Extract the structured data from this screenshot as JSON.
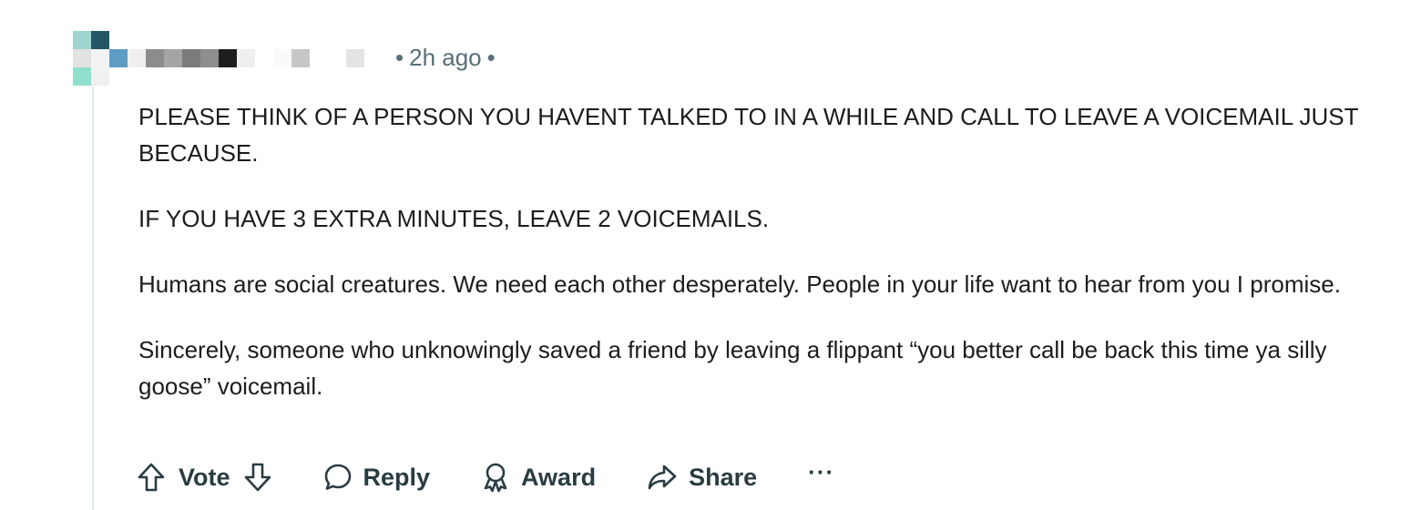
{
  "comment": {
    "meta": {
      "separator": "•",
      "timestamp": "2h ago"
    },
    "body": [
      "PLEASE THINK OF A PERSON YOU HAVENT TALKED TO IN A WHILE AND CALL TO LEAVE A VOICEMAIL JUST BECAUSE.",
      "IF YOU HAVE 3 EXTRA MINUTES, LEAVE 2 VOICEMAILS.",
      "Humans are social creatures. We need each other desperately. People in your life want to hear from you I promise.",
      "Sincerely, someone who unknowingly saved a friend by leaving a flippant “you better call be back this time ya silly goose” voicemail."
    ]
  },
  "actions": {
    "vote_label": "Vote",
    "reply_label": "Reply",
    "award_label": "Award",
    "share_label": "Share",
    "more_label": "···",
    "icons": {
      "upvote": "arrow-up-icon",
      "downvote": "arrow-down-icon",
      "reply": "speech-bubble-icon",
      "award": "award-ribbon-icon",
      "share": "share-arrow-icon"
    }
  },
  "colors": {
    "text": "#1c1c1c",
    "meta": "#576f76",
    "action": "#2a3c42",
    "thread_line": "#e5ebee"
  }
}
